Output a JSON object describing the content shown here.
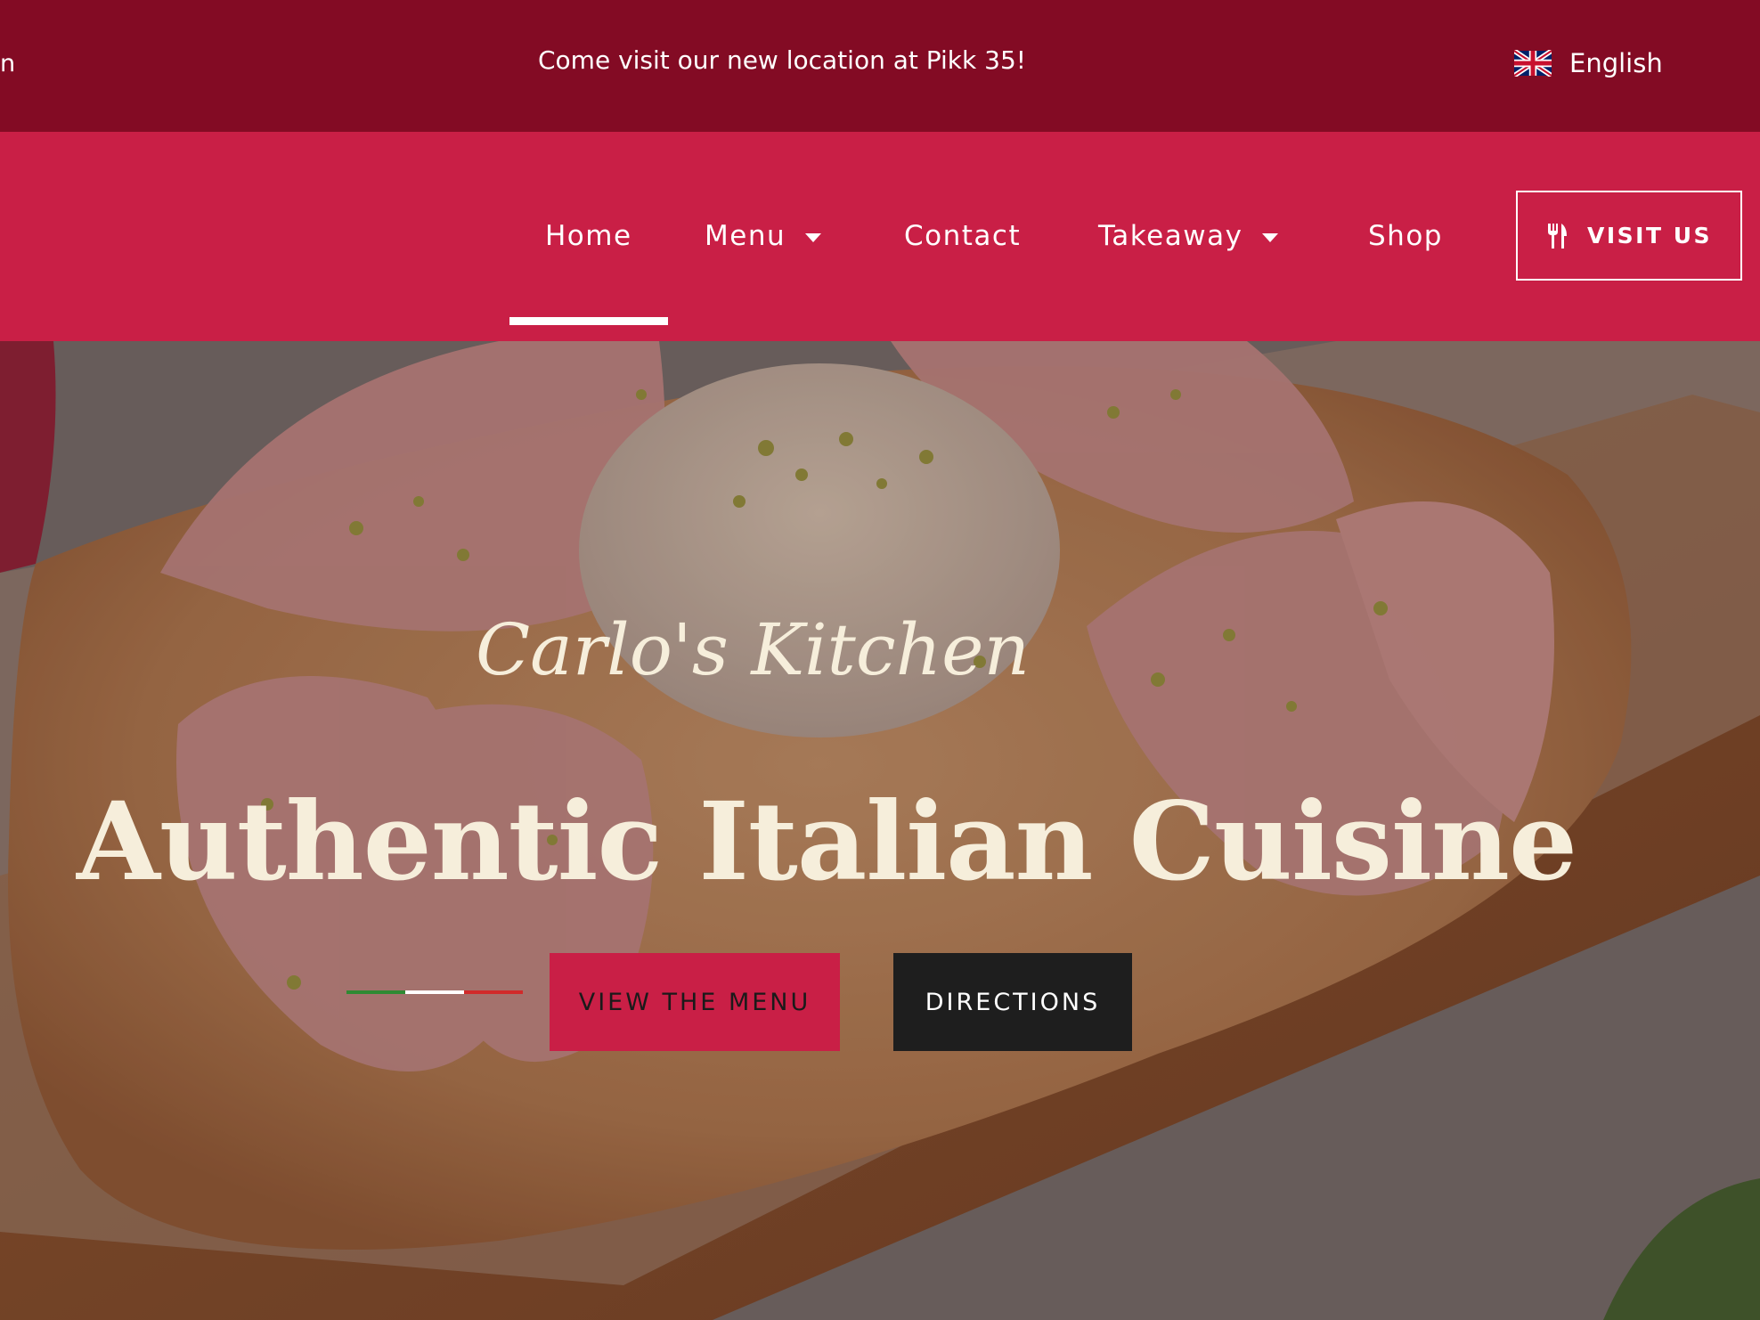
{
  "topbar": {
    "partial_left_text": "n",
    "announcement": "Come visit our new location at Pikk 35!",
    "language": {
      "label": "English",
      "flag_icon": "uk-flag-icon"
    }
  },
  "nav": {
    "items": [
      {
        "label": "Home",
        "active": true,
        "dropdown": false
      },
      {
        "label": "Menu",
        "active": false,
        "dropdown": true
      },
      {
        "label": "Contact",
        "active": false,
        "dropdown": false
      },
      {
        "label": "Takeaway",
        "active": false,
        "dropdown": true
      },
      {
        "label": "Shop",
        "active": false,
        "dropdown": false
      }
    ],
    "cta": {
      "label": "VISIT US",
      "icon": "fork-knife-icon"
    }
  },
  "hero": {
    "script_title": "Carlo's Kitchen",
    "headline": "Authentic Italian Cuisine",
    "buttons": {
      "menu": "VIEW THE MENU",
      "directions": "DIRECTIONS"
    }
  },
  "colors": {
    "topbar_bg": "#830b24",
    "navbar_bg": "#c91f46",
    "accent": "#c91f46",
    "dark_button": "#1e1e1e",
    "cream_text": "#f6eedb"
  }
}
